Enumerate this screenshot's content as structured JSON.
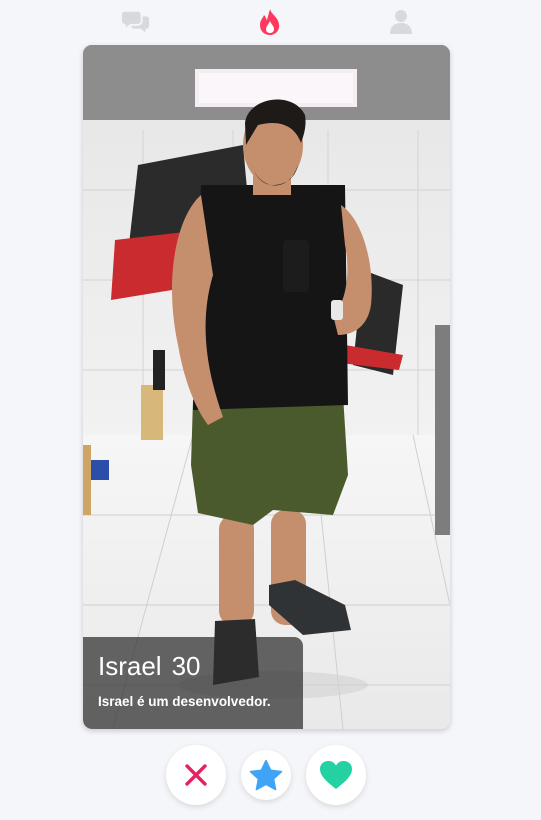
{
  "nav": {
    "chat_icon": "chat-bubbles-icon",
    "flame_icon": "flame-icon",
    "profile_icon": "user-icon",
    "active": "flame",
    "colors": {
      "inactive": "#d6d9de",
      "active": "#fd3a5e"
    }
  },
  "profile": {
    "name": "Israel",
    "age": "30",
    "bio": "Israel é um desenvolvedor."
  },
  "actions": {
    "nope_icon": "close-icon",
    "super_like_icon": "star-icon",
    "like_icon": "heart-icon",
    "colors": {
      "nope": "#e5235f",
      "super_like": "#3fa4f5",
      "like": "#23d1a2"
    }
  }
}
